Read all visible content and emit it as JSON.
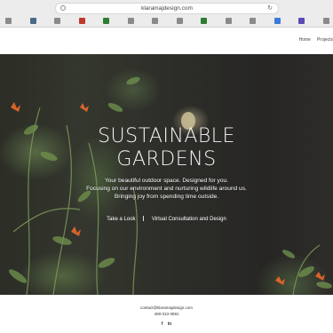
{
  "browser": {
    "url": "klaramajdesign.com",
    "bookmark_colors": [
      "#8a8a8a",
      "#4a6a8a",
      "#8a8a8a",
      "#c0392b",
      "#2e7d32",
      "#8a8a8a",
      "#8a8a8a",
      "#8a8a8a",
      "#2e7d32",
      "#8a8a8a",
      "#8a8a8a",
      "#3b7bd8",
      "#5b4ab8",
      "#8a8a8a"
    ]
  },
  "nav": {
    "items": [
      "Home",
      "Projects"
    ]
  },
  "hero": {
    "title_line1": "SUSTAINABLE",
    "title_line2": "GARDENS",
    "sub_line1": "Your beautiful outdoor space. Designed for you.",
    "sub_line2": "Focusing on our environment and nurturing wildlife around us.",
    "sub_line3": "Bringing joy from spending time outside.",
    "cta_look": "Take a Look",
    "cta_consult": "Virtual Consultation and Design"
  },
  "footer": {
    "email": "contact@klaramajdesign.com",
    "phone": "408-313-3581",
    "facebook": "f",
    "linkedin": "in"
  }
}
